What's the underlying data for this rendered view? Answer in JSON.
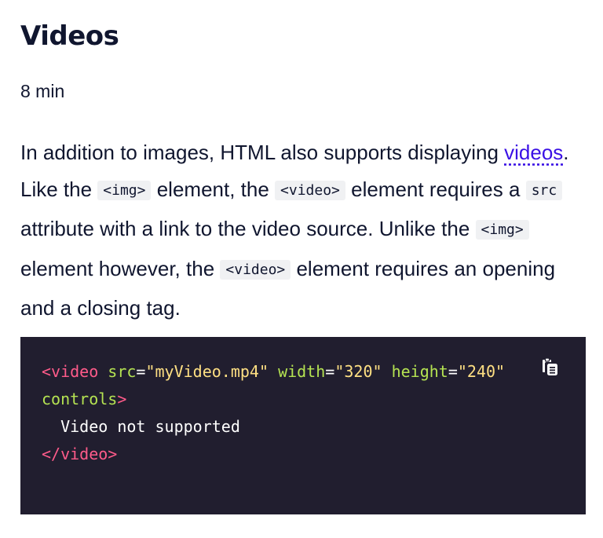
{
  "header": {
    "title": "Videos",
    "duration": "8 min"
  },
  "paragraph": {
    "part1": "In addition to images, HTML also supports displaying ",
    "link_text": "videos",
    "part2": ". Like the ",
    "code1": "<img>",
    "part3": " element, the ",
    "code2": "<video>",
    "part4": " element requires a ",
    "code3": "src",
    "part5": " attribute with a link to the video source. Unlike the ",
    "code4": "<img>",
    "part6": " element however, the ",
    "code5": "<video>",
    "part7": " element requires an opening and a closing tag."
  },
  "code_block": {
    "tokens": {
      "open_tag": "<video",
      "space1": " ",
      "attr_src": "src",
      "eq1": "=",
      "val_src": "\"myVideo.mp4\"",
      "space2": " ",
      "attr_width": "width",
      "eq2": "=",
      "val_width": "\"320\"",
      "space3": " ",
      "attr_height": "height",
      "eq3": "=",
      "val_height": "\"240\"",
      "attr_controls": "controls",
      "close_bracket": ">",
      "inner_text": "  Video not supported",
      "close_tag": "</video>"
    },
    "copy_icon": "copy-icon"
  },
  "colors": {
    "text": "#10162f",
    "link": "#3a10e5",
    "inline_code_bg": "#f0f1f3",
    "code_bg": "#211e2f",
    "tag": "#ff5b8a",
    "attr": "#b5e352",
    "string": "#ffe083"
  }
}
